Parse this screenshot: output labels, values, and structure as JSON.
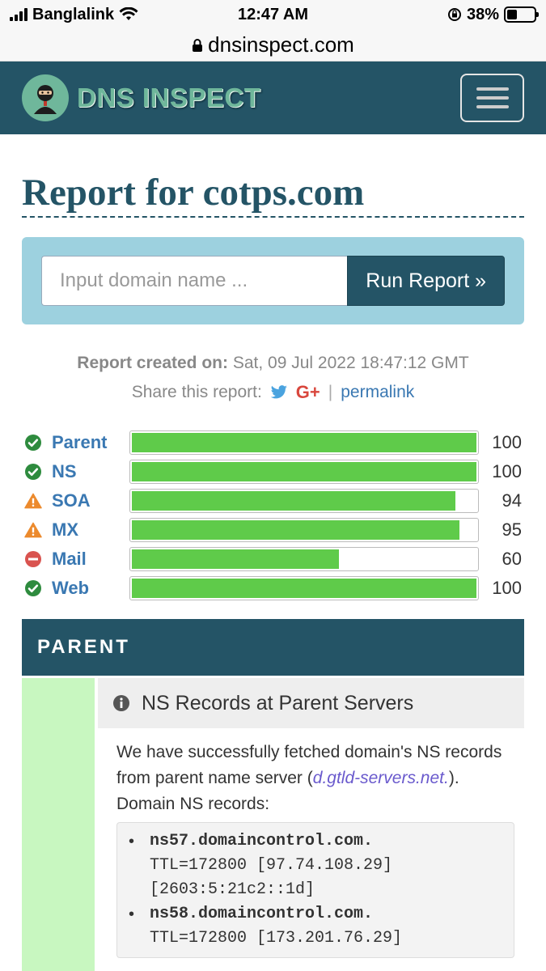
{
  "status_bar": {
    "carrier": "Banglalink",
    "time": "12:47 AM",
    "battery_percent": "38%",
    "battery_level": 0.38
  },
  "url_bar": {
    "url": "dnsinspect.com"
  },
  "navbar": {
    "brand": "DNS INSPECT"
  },
  "page": {
    "title": "Report for cotps.com",
    "search": {
      "placeholder": "Input domain name ...",
      "button_label": "Run Report »"
    },
    "created_label": "Report created on:",
    "created_value": "Sat, 09 Jul 2022 18:47:12 GMT",
    "share_label": "Share this report:",
    "gplus": "G+",
    "separator": "|",
    "permalink": "permalink"
  },
  "scores": [
    {
      "label": "Parent",
      "value": 100,
      "status": "ok"
    },
    {
      "label": "NS",
      "value": 100,
      "status": "ok"
    },
    {
      "label": "SOA",
      "value": 94,
      "status": "warning"
    },
    {
      "label": "MX",
      "value": 95,
      "status": "warning"
    },
    {
      "label": "Mail",
      "value": 60,
      "status": "error"
    },
    {
      "label": "Web",
      "value": 100,
      "status": "ok"
    }
  ],
  "colors": {
    "ok": "#2e8b3e",
    "warning": "#ec8a2d",
    "error": "#d9534f",
    "bar_fill": "#5fcb4a",
    "primary": "#245466"
  },
  "section": {
    "title": "PARENT",
    "check_title": "NS Records at Parent Servers",
    "text_before": "We have successfully fetched domain's NS records from parent name server (",
    "parent_server": "d.gtld-servers.net.",
    "text_after": ").",
    "records_label": "Domain NS records:",
    "records": [
      {
        "host": "ns57.domaincontrol.com.",
        "ttl": "TTL=172800",
        "ipv4": "[97.74.108.29]",
        "ipv6": "[2603:5:21c2::1d]"
      },
      {
        "host": "ns58.domaincontrol.com.",
        "ttl": "TTL=172800",
        "ipv4": "[173.201.76.29]",
        "ipv6": ""
      }
    ]
  }
}
